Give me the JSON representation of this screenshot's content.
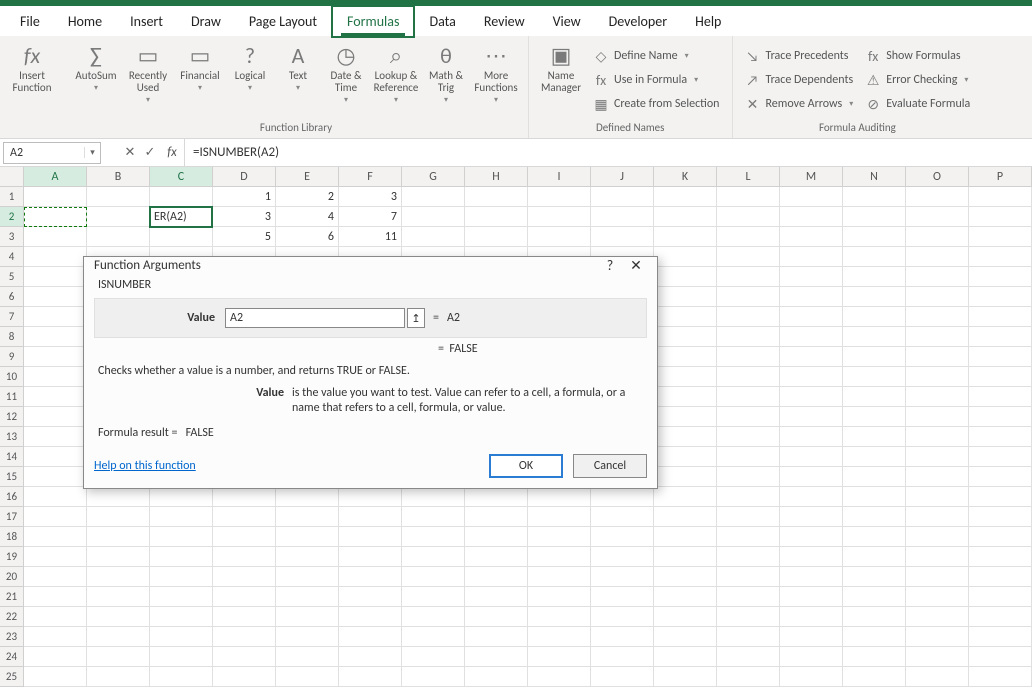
{
  "menu": {
    "file": "File",
    "home": "Home",
    "insert": "Insert",
    "draw": "Draw",
    "page_layout": "Page Layout",
    "formulas": "Formulas",
    "data": "Data",
    "review": "Review",
    "view": "View",
    "developer": "Developer",
    "help": "Help"
  },
  "ribbon": {
    "insert_function": "Insert\nFunction",
    "autosum": "AutoSum",
    "recently_used": "Recently\nUsed",
    "financial": "Financial",
    "logical": "Logical",
    "text": "Text",
    "date_time": "Date &\nTime",
    "lookup_ref": "Lookup &\nReference",
    "math_trig": "Math &\nTrig",
    "more_fn": "More\nFunctions",
    "group_library": "Function Library",
    "name_manager": "Name\nManager",
    "define_name": "Define Name",
    "use_in_formula": "Use in Formula",
    "create_from_sel": "Create from Selection",
    "group_defined": "Defined Names",
    "trace_prec": "Trace Precedents",
    "trace_dep": "Trace Dependents",
    "remove_arrows": "Remove Arrows",
    "show_formulas": "Show Formulas",
    "error_checking": "Error Checking",
    "evaluate_formula": "Evaluate Formula",
    "group_auditing": "Formula Auditing"
  },
  "fx": {
    "name": "A2",
    "cancel": "✕",
    "enter": "✓",
    "fx": "fx",
    "formula": "=ISNUMBER(A2)"
  },
  "cols": [
    "A",
    "B",
    "C",
    "D",
    "E",
    "F",
    "G",
    "H",
    "I",
    "J",
    "K",
    "L",
    "M",
    "N",
    "O",
    "P"
  ],
  "rows": [
    "1",
    "2",
    "3",
    "4",
    "5",
    "6",
    "7",
    "8",
    "9",
    "10",
    "11",
    "12",
    "13",
    "14",
    "15",
    "16",
    "17",
    "18",
    "19",
    "20",
    "21",
    "22",
    "23",
    "24",
    "25"
  ],
  "cells": {
    "C2": "ER(A2)",
    "D1": "1",
    "D2": "3",
    "D3": "5",
    "E1": "2",
    "E2": "4",
    "E3": "6",
    "F1": "3",
    "F2": "7",
    "F3": "11"
  },
  "dialog": {
    "title": "Function Arguments",
    "help_icon": "?",
    "close_icon": "✕",
    "fn_name": "ISNUMBER",
    "arg_label": "Value",
    "arg_value": "A2",
    "arg_eq": "=",
    "arg_result": "A2",
    "res_eq": "=",
    "res_val": "FALSE",
    "description": "Checks whether a value is a number, and returns TRUE or FALSE.",
    "argdesc_label": "Value",
    "argdesc_text": "is the value you want to test. Value can refer to a cell, a formula, or a name that refers to a cell, formula, or value.",
    "formula_result_label": "Formula result =",
    "formula_result_value": "FALSE",
    "help_link": "Help on this function",
    "ok": "OK",
    "cancel": "Cancel"
  }
}
